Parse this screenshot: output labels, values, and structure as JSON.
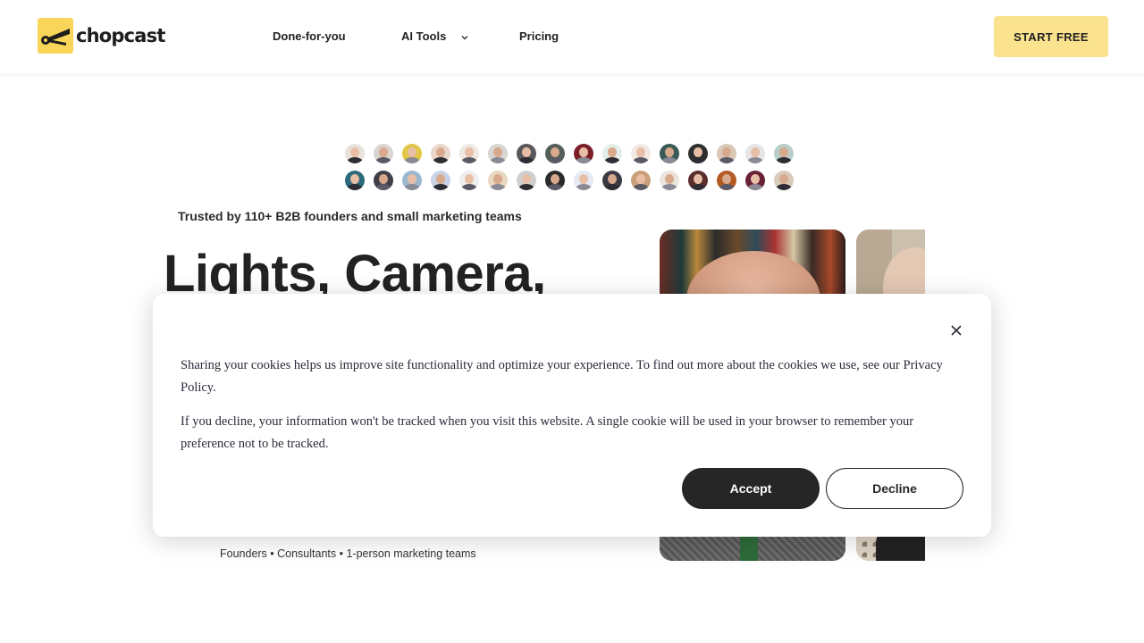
{
  "header": {
    "logo_text": "chopcast",
    "nav": [
      {
        "label": "Done-for-you"
      },
      {
        "label": "AI Tools"
      },
      {
        "label": "Pricing"
      }
    ],
    "cta_label": "START FREE"
  },
  "hero": {
    "trusted_text": "Trusted by 110+ B2B founders and small marketing teams",
    "title": "Lights, Camera,",
    "audience": "Founders • Consultants • 1-person marketing teams"
  },
  "avatars": {
    "row1": [
      "#e8e2dc",
      "#d9d4cf",
      "#e1c544",
      "#ead7cc",
      "#efe9e4",
      "#d9d5d0",
      "#58585a",
      "#56605a",
      "#7a1f2a",
      "#e3f0ea",
      "#f1e9e2",
      "#3a5a58",
      "#2f2f2f",
      "#d9c8b8",
      "#e5e5e5",
      "#b8cfc9"
    ],
    "row2": [
      "#2a6a7c",
      "#3f3f48",
      "#9cb8d1",
      "#c9d3e8",
      "#eeeeee",
      "#e9d7c1",
      "#cfcfcf",
      "#2b2b2b",
      "#e5e9f2",
      "#3a3a44",
      "#c9a07a",
      "#ebe4dc",
      "#5a2e2a",
      "#b35a25",
      "#6a2136",
      "#d8cbbb"
    ]
  },
  "cookie": {
    "paragraph1": "Sharing your cookies helps us improve site functionality and optimize your experience. To find out more about the cookies we use, see our Privacy Policy.",
    "paragraph2": "If you decline, your information won't be tracked when you visit this website. A single cookie will be used in your browser to remember your preference not to be tracked.",
    "accept_label": "Accept",
    "decline_label": "Decline"
  },
  "colors": {
    "brand_yellow": "#f9d559",
    "cta_yellow": "#fae28e",
    "dark": "#262626"
  }
}
